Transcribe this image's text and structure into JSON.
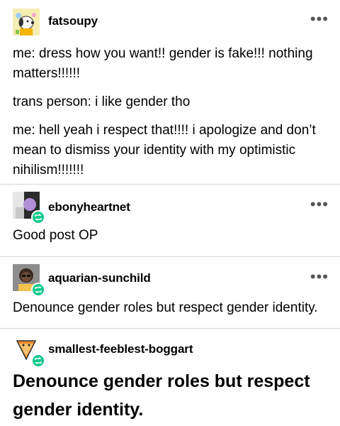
{
  "posts": [
    {
      "username": "fatsoupy",
      "lines": [
        "me: dress how you want!! gender is fake!!! nothing matters!!!!!!",
        "trans person: i like gender tho",
        "me: hell yeah i respect that!!!! i apologize and don’t mean to dismiss your identity with my optimistic nihilism!!!!!!!"
      ]
    },
    {
      "username": "ebonyheartnet",
      "text": "Good post OP"
    },
    {
      "username": "aquarian-sunchild",
      "text": "Denounce gender roles but respect gender identity."
    },
    {
      "username": "smallest-feeblest-boggart",
      "text": "Denounce gender roles but respect gender identity."
    }
  ],
  "more_icon_glyph": "•••",
  "colors": {
    "reblog_badge": "#10c98a",
    "separator": "#d6d6d6"
  }
}
